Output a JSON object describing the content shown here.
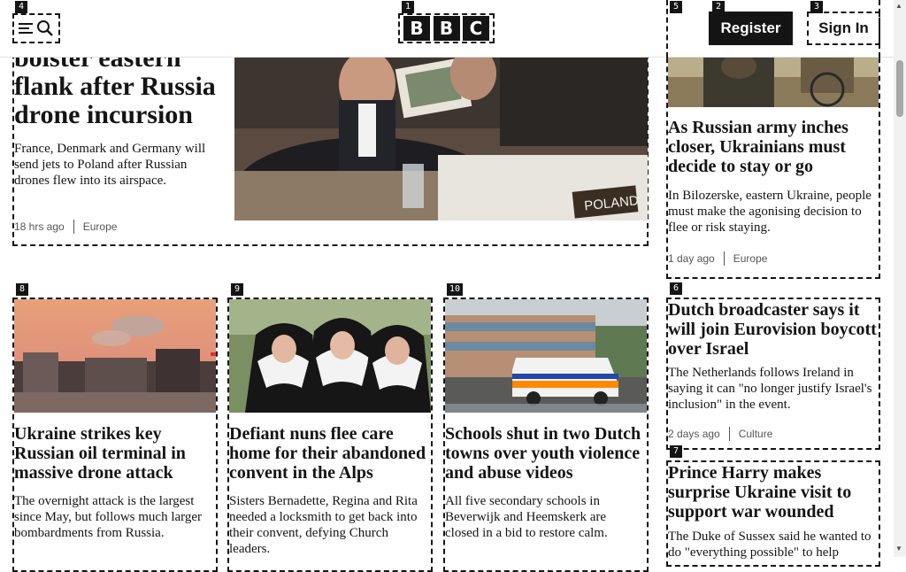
{
  "header": {
    "logo_letters": [
      "B",
      "B",
      "C"
    ],
    "register_label": "Register",
    "signin_label": "Sign In",
    "marks": {
      "menu": "4",
      "logo": "1",
      "register": "2",
      "signin": "3"
    }
  },
  "lead": {
    "headline": "bolster eastern flank after Russia drone incursion",
    "summary": "France, Denmark and Germany will send jets to Poland after Russian drones flew into its airspace.",
    "time": "18 hrs ago",
    "section": "Europe",
    "nameplate": "POLAND"
  },
  "side": [
    {
      "mark": "5",
      "headline": "As Russian army inches closer, Ukrainians must decide to stay or go",
      "summary": "In Bilozerske, eastern Ukraine, people must make the agonising decision to flee or risk staying.",
      "time": "1 day ago",
      "section": "Europe"
    },
    {
      "mark": "6",
      "headline": "Dutch broadcaster says it will join Eurovision boycott over Israel",
      "summary": "The Netherlands follows Ireland in saying it can \"no longer justify Israel's inclusion\" in the event.",
      "time": "2 days ago",
      "section": "Culture"
    },
    {
      "mark": "7",
      "headline": "Prince Harry makes surprise Ukraine visit to support war wounded",
      "summary": "The Duke of Sussex said he wanted to do \"everything possible\" to help"
    }
  ],
  "cards": [
    {
      "mark": "8",
      "headline": "Ukraine strikes key Russian oil terminal in massive drone attack",
      "summary": "The overnight attack is the largest since May, but follows much larger bombardments from Russia."
    },
    {
      "mark": "9",
      "headline": "Defiant nuns flee care home for their abandoned convent in the Alps",
      "summary": "Sisters Bernadette, Regina and Rita needed a locksmith to get back into their convent, defying Church leaders."
    },
    {
      "mark": "10",
      "headline": "Schools shut in two Dutch towns over youth violence and abuse videos",
      "summary": "All five secondary schools in Beverwijk and Heemskerk are closed in a bid to restore calm."
    }
  ],
  "colors": {
    "ink": "#141414",
    "meta": "#545658",
    "accent_sky": "#e8a07a"
  }
}
